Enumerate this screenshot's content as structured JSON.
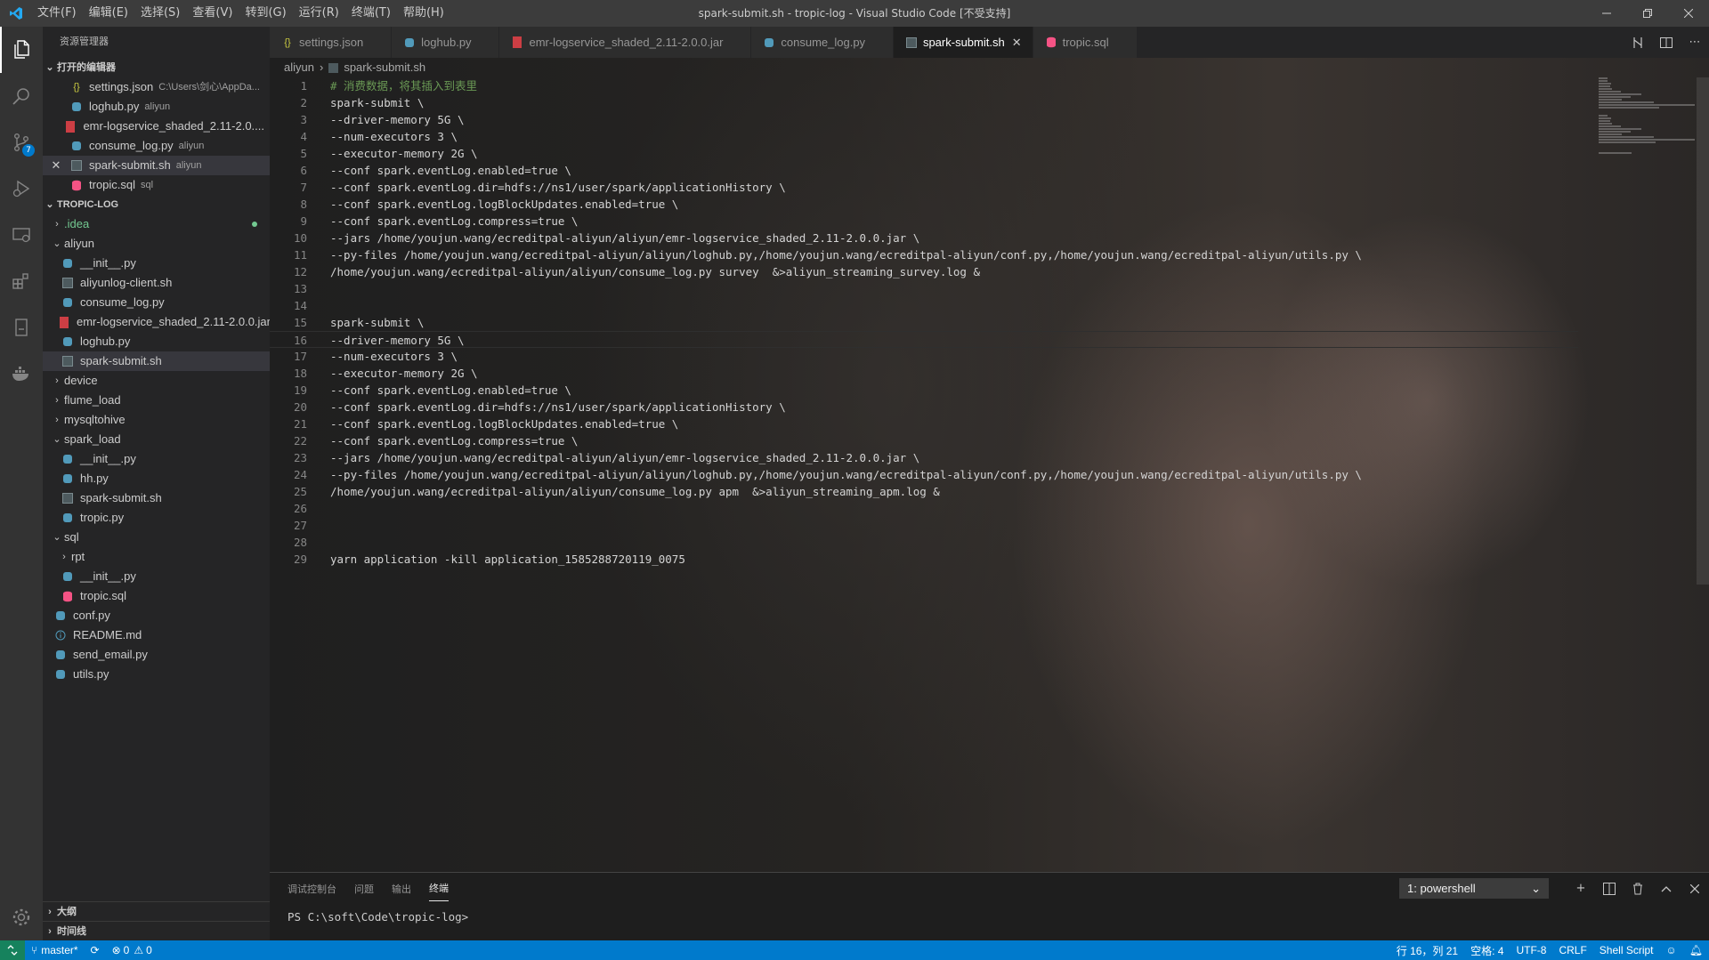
{
  "window": {
    "title": "spark-submit.sh - tropic-log - Visual Studio Code [不受支持]",
    "menu": [
      "文件(F)",
      "编辑(E)",
      "选择(S)",
      "查看(V)",
      "转到(G)",
      "运行(R)",
      "终端(T)",
      "帮助(H)"
    ]
  },
  "activity": {
    "source_control_badge": "7"
  },
  "sidebar": {
    "title": "资源管理器",
    "open_editors_label": "打开的编辑器",
    "open_editors": [
      {
        "name": "settings.json",
        "desc": "C:\\Users\\剑心\\AppDa...",
        "icon": "json-icon",
        "close": false
      },
      {
        "name": "loghub.py",
        "desc": "aliyun",
        "icon": "python-icon",
        "close": false
      },
      {
        "name": "emr-logservice_shaded_2.11-2.0....",
        "desc": "",
        "icon": "jar-icon",
        "close": false
      },
      {
        "name": "consume_log.py",
        "desc": "aliyun",
        "icon": "python-icon",
        "close": false
      },
      {
        "name": "spark-submit.sh",
        "desc": "aliyun",
        "icon": "shell-icon",
        "close": true
      },
      {
        "name": "tropic.sql",
        "desc": "sql",
        "icon": "sql-icon",
        "close": false
      }
    ],
    "project_label": "TROPIC-LOG",
    "tree": [
      {
        "name": ".idea",
        "indent": 0,
        "type": "folder",
        "open": false,
        "color": "#73c991"
      },
      {
        "name": "aliyun",
        "indent": 0,
        "type": "folder",
        "open": true
      },
      {
        "name": "__init__.py",
        "indent": 1,
        "type": "python-icon"
      },
      {
        "name": "aliyunlog-client.sh",
        "indent": 1,
        "type": "shell-icon"
      },
      {
        "name": "consume_log.py",
        "indent": 1,
        "type": "python-icon"
      },
      {
        "name": "emr-logservice_shaded_2.11-2.0.0.jar",
        "indent": 1,
        "type": "jar-icon"
      },
      {
        "name": "loghub.py",
        "indent": 1,
        "type": "python-icon"
      },
      {
        "name": "spark-submit.sh",
        "indent": 1,
        "type": "shell-icon",
        "selected": true
      },
      {
        "name": "device",
        "indent": 0,
        "type": "folder",
        "open": false
      },
      {
        "name": "flume_load",
        "indent": 0,
        "type": "folder",
        "open": false
      },
      {
        "name": "mysqltohive",
        "indent": 0,
        "type": "folder",
        "open": false
      },
      {
        "name": "spark_load",
        "indent": 0,
        "type": "folder",
        "open": true
      },
      {
        "name": "__init__.py",
        "indent": 1,
        "type": "python-icon"
      },
      {
        "name": "hh.py",
        "indent": 1,
        "type": "python-icon"
      },
      {
        "name": "spark-submit.sh",
        "indent": 1,
        "type": "shell-icon"
      },
      {
        "name": "tropic.py",
        "indent": 1,
        "type": "python-icon"
      },
      {
        "name": "sql",
        "indent": 0,
        "type": "folder",
        "open": true
      },
      {
        "name": "rpt",
        "indent": 1,
        "type": "folder",
        "open": false
      },
      {
        "name": "__init__.py",
        "indent": 1,
        "type": "python-icon"
      },
      {
        "name": "tropic.sql",
        "indent": 1,
        "type": "sql-icon"
      },
      {
        "name": "conf.py",
        "indent": 0,
        "type": "python-icon"
      },
      {
        "name": "README.md",
        "indent": 0,
        "type": "info-icon"
      },
      {
        "name": "send_email.py",
        "indent": 0,
        "type": "python-icon"
      },
      {
        "name": "utils.py",
        "indent": 0,
        "type": "python-icon"
      }
    ],
    "outline_label": "大纲",
    "timeline_label": "时间线"
  },
  "tabs": [
    {
      "label": "settings.json",
      "icon": "json-icon",
      "active": false
    },
    {
      "label": "loghub.py",
      "icon": "python-icon",
      "active": false
    },
    {
      "label": "emr-logservice_shaded_2.11-2.0.0.jar",
      "icon": "jar-icon",
      "active": false
    },
    {
      "label": "consume_log.py",
      "icon": "python-icon",
      "active": false
    },
    {
      "label": "spark-submit.sh",
      "icon": "shell-icon",
      "active": true
    },
    {
      "label": "tropic.sql",
      "icon": "sql-icon",
      "active": false
    }
  ],
  "breadcrumb": {
    "folder": "aliyun",
    "file": "spark-submit.sh"
  },
  "code": [
    "# 消费数据，将其插入到表里",
    "spark-submit \\",
    "--driver-memory 5G \\",
    "--num-executors 3 \\",
    "--executor-memory 2G \\",
    "--conf spark.eventLog.enabled=true \\",
    "--conf spark.eventLog.dir=hdfs://ns1/user/spark/applicationHistory \\",
    "--conf spark.eventLog.logBlockUpdates.enabled=true \\",
    "--conf spark.eventLog.compress=true \\",
    "--jars /home/youjun.wang/ecreditpal-aliyun/aliyun/emr-logservice_shaded_2.11-2.0.0.jar \\",
    "--py-files /home/youjun.wang/ecreditpal-aliyun/aliyun/loghub.py,/home/youjun.wang/ecreditpal-aliyun/conf.py,/home/youjun.wang/ecreditpal-aliyun/utils.py \\",
    "/home/youjun.wang/ecreditpal-aliyun/aliyun/consume_log.py survey  &>aliyun_streaming_survey.log &",
    "",
    "",
    "spark-submit \\",
    "--driver-memory 5G \\",
    "--num-executors 3 \\",
    "--executor-memory 2G \\",
    "--conf spark.eventLog.enabled=true \\",
    "--conf spark.eventLog.dir=hdfs://ns1/user/spark/applicationHistory \\",
    "--conf spark.eventLog.logBlockUpdates.enabled=true \\",
    "--conf spark.eventLog.compress=true \\",
    "--jars /home/youjun.wang/ecreditpal-aliyun/aliyun/emr-logservice_shaded_2.11-2.0.0.jar \\",
    "--py-files /home/youjun.wang/ecreditpal-aliyun/aliyun/loghub.py,/home/youjun.wang/ecreditpal-aliyun/conf.py,/home/youjun.wang/ecreditpal-aliyun/utils.py \\",
    "/home/youjun.wang/ecreditpal-aliyun/aliyun/consume_log.py apm  &>aliyun_streaming_apm.log &",
    "",
    "",
    "",
    "yarn application -kill application_1585288720119_0075"
  ],
  "current_line": 16,
  "panel": {
    "tabs": [
      "调试控制台",
      "问题",
      "输出",
      "终端"
    ],
    "active_tab": "终端",
    "terminal_select": "1: powershell",
    "prompt": "PS C:\\soft\\Code\\tropic-log>"
  },
  "status": {
    "branch": "master*",
    "errors": "0",
    "warnings": "0",
    "position": "行 16，列 21",
    "spaces": "空格: 4",
    "encoding": "UTF-8",
    "eol": "CRLF",
    "language": "Shell Script"
  },
  "colors": {
    "accent": "#007acc",
    "python": "#519aba",
    "json": "#cbcb41",
    "jar": "#cc3e44",
    "sql": "#f55385",
    "shell": "#4d5a5e",
    "comment": "#6a9955"
  }
}
